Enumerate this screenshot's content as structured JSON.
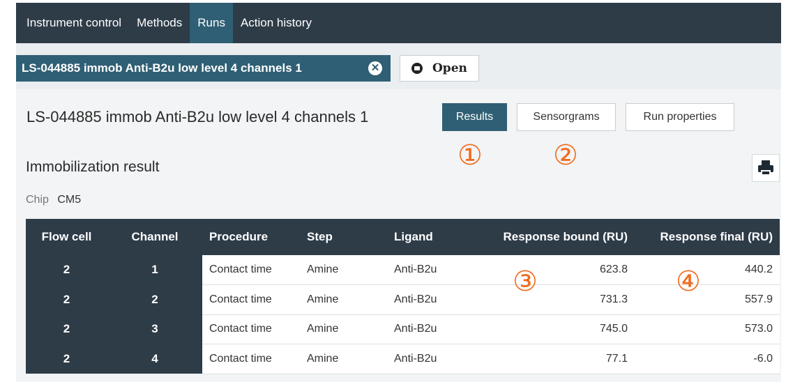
{
  "nav": {
    "items": [
      {
        "label": "Instrument control"
      },
      {
        "label": "Methods"
      },
      {
        "label": "Runs",
        "active": true
      },
      {
        "label": "Action history"
      }
    ]
  },
  "doc_tab": {
    "label": "LS-044885 immob Anti-B2u low level 4 channels 1",
    "close_icon": "close-circle-icon"
  },
  "open_button": {
    "label": "Open",
    "icon": "folder-open-icon"
  },
  "page": {
    "title": "LS-044885 immob Anti-B2u low level 4 channels 1",
    "buttons": {
      "results": "Results",
      "sensorgrams": "Sensorgrams",
      "run_properties": "Run properties"
    }
  },
  "section": {
    "title": "Immobilization result",
    "print_icon": "print-icon"
  },
  "chip": {
    "label": "Chip",
    "value": "CM5"
  },
  "callouts": [
    "①",
    "②",
    "③",
    "④"
  ],
  "table": {
    "headers": [
      "Flow cell",
      "Channel",
      "Procedure",
      "Step",
      "Ligand",
      "Response bound (RU)",
      "Response final (RU)"
    ],
    "rows": [
      [
        "2",
        "1",
        "Contact time",
        "Amine",
        "Anti-B2u",
        "623.8",
        "440.2"
      ],
      [
        "2",
        "2",
        "Contact time",
        "Amine",
        "Anti-B2u",
        "731.3",
        "557.9"
      ],
      [
        "2",
        "3",
        "Contact time",
        "Amine",
        "Anti-B2u",
        "745.0",
        "573.0"
      ],
      [
        "2",
        "4",
        "Contact time",
        "Amine",
        "Anti-B2u",
        "77.1",
        "-6.0"
      ]
    ]
  },
  "colors": {
    "nav_bg": "#2e3c48",
    "accent": "#2f5f74",
    "callout": "#f26a1b",
    "panel_bg": "#f2f4f5"
  }
}
